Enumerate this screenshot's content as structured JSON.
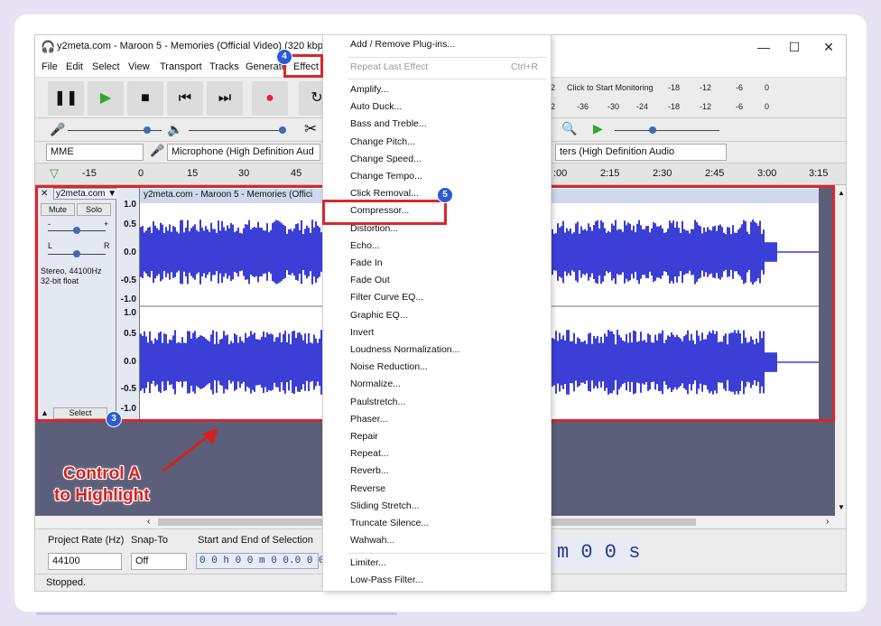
{
  "window": {
    "title": "y2meta.com - Maroon 5 - Memories (Official Video) (320 kbps)",
    "min": "—",
    "max": "☐",
    "close": "✕"
  },
  "menubar": [
    "File",
    "Edit",
    "Select",
    "View",
    "Transport",
    "Tracks",
    "Generate",
    "Effect"
  ],
  "meters": {
    "monitor_text": "Click to Start Monitoring",
    "row1": [
      "2",
      "-18",
      "-12",
      "-6",
      "0"
    ],
    "row2": [
      "2",
      "-36",
      "-30",
      "-24",
      "-18",
      "-12",
      "-6",
      "0"
    ]
  },
  "device": {
    "host": "MME",
    "input": "Microphone (High Definition Aud",
    "output": "ters (High Definition Audio"
  },
  "timeline": {
    "left": [
      "-15",
      "0",
      "15",
      "30",
      "45"
    ],
    "right": [
      ":00",
      "2:15",
      "2:30",
      "2:45",
      "3:00",
      "3:15"
    ]
  },
  "track": {
    "name": "y2meta.com",
    "mute": "Mute",
    "solo": "Solo",
    "minus": "-",
    "plus": "+",
    "l": "L",
    "r": "R",
    "info1": "Stereo, 44100Hz",
    "info2": "32-bit float",
    "select": "Select",
    "clip_title": "y2meta.com - Maroon 5 - Memories (Offici",
    "scale_top": [
      "1.0",
      "0.5",
      "0.0",
      "-0.5",
      "-1.0"
    ],
    "scale_bottom": [
      "1.0",
      "0.5",
      "0.0",
      "-0.5",
      "-1.0"
    ]
  },
  "selection_toolbar": {
    "rate_label": "Project Rate (Hz)",
    "snap_label": "Snap-To",
    "sel_label": "Start and End of Selection",
    "rate_value": "44100",
    "snap_value": "Off",
    "sel_value": "0 0 h 0 0 m 0 0.0 0 0 s",
    "big_time": "m 0 0 s"
  },
  "status": "Stopped.",
  "effect_menu": {
    "top": [
      "Add / Remove Plug-ins..."
    ],
    "repeat_last": "Repeat Last Effect",
    "repeat_shortcut": "Ctrl+R",
    "items": [
      "Amplify...",
      "Auto Duck...",
      "Bass and Treble...",
      "Change Pitch...",
      "Change Speed...",
      "Change Tempo...",
      "Click Removal...",
      "Compressor...",
      "Distortion...",
      "Echo...",
      "Fade In",
      "Fade Out",
      "Filter Curve EQ...",
      "Graphic EQ...",
      "Invert",
      "Loudness Normalization...",
      "Noise Reduction...",
      "Normalize...",
      "Paulstretch...",
      "Phaser...",
      "Repair",
      "Repeat...",
      "Reverb...",
      "Reverse",
      "Sliding Stretch...",
      "Truncate Silence...",
      "Wahwah..."
    ],
    "bottom": [
      "Limiter...",
      "Low-Pass Filter..."
    ]
  },
  "annotations": {
    "badge3": "3",
    "badge4": "4",
    "badge5": "5",
    "control_a_line1": "Control A",
    "control_a_line2": "to Highlight"
  },
  "colors": {
    "waveform": "#3b3fd6",
    "highlight": "#d9262c",
    "badge": "#2a5bd8"
  }
}
